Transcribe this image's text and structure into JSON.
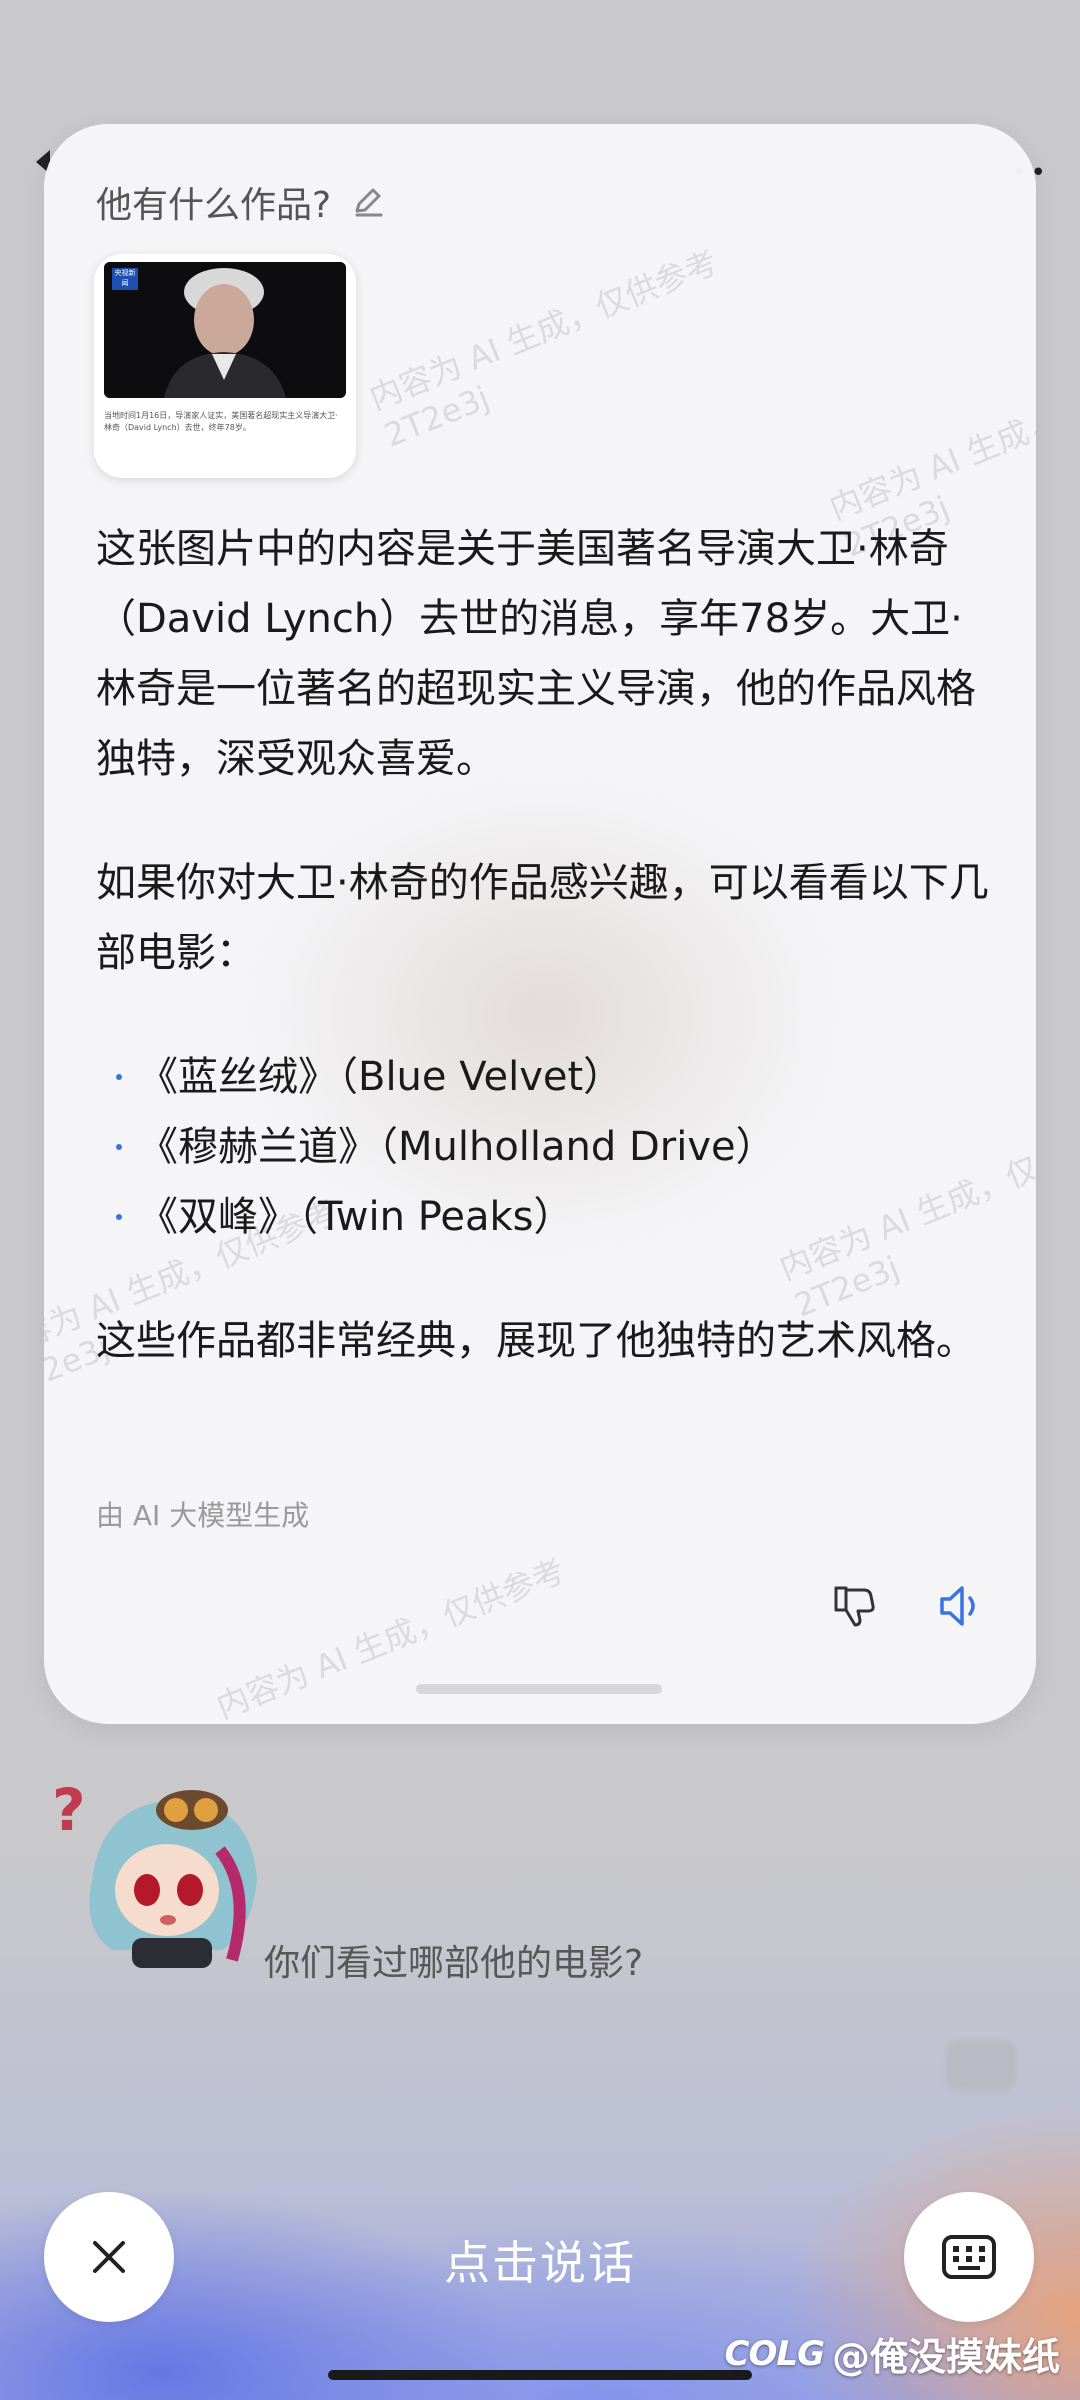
{
  "card": {
    "question": "他有什么作品?",
    "thumbnail": {
      "badge": "央视新闻",
      "caption": "当地时间1月16日，导演家人证实，美国著名超现实主义导演大卫·林奇（David Lynch）去世，终年78岁。"
    },
    "answer": {
      "paragraph1": "这张图片中的内容是关于美国著名导演大卫·林奇（David Lynch）去世的消息，享年78岁。大卫·林奇是一位著名的超现实主义导演，他的作品风格独特，深受观众喜爱。",
      "paragraph2": "如果你对大卫·林奇的作品感兴趣，可以看看以下几部电影：",
      "films": [
        "《蓝丝绒》（Blue Velvet）",
        "《穆赫兰道》（Mulholland Drive）",
        "《双峰》（Twin Peaks）"
      ],
      "paragraph3": "这些作品都非常经典，展现了他独特的艺术风格。"
    },
    "ai_note": "由 AI 大模型生成",
    "watermark": "内容为 AI 生成，仅供参考",
    "watermark_code": "2T2e3j"
  },
  "chat": {
    "message": "你们看过哪部他的电影?"
  },
  "controls": {
    "speak_label": "点击说话"
  },
  "credit": {
    "logo": "COLG",
    "user": "@俺没摸妹纸"
  },
  "colors": {
    "accent": "#3a74e0",
    "card_bg": "#f6f6f8"
  }
}
